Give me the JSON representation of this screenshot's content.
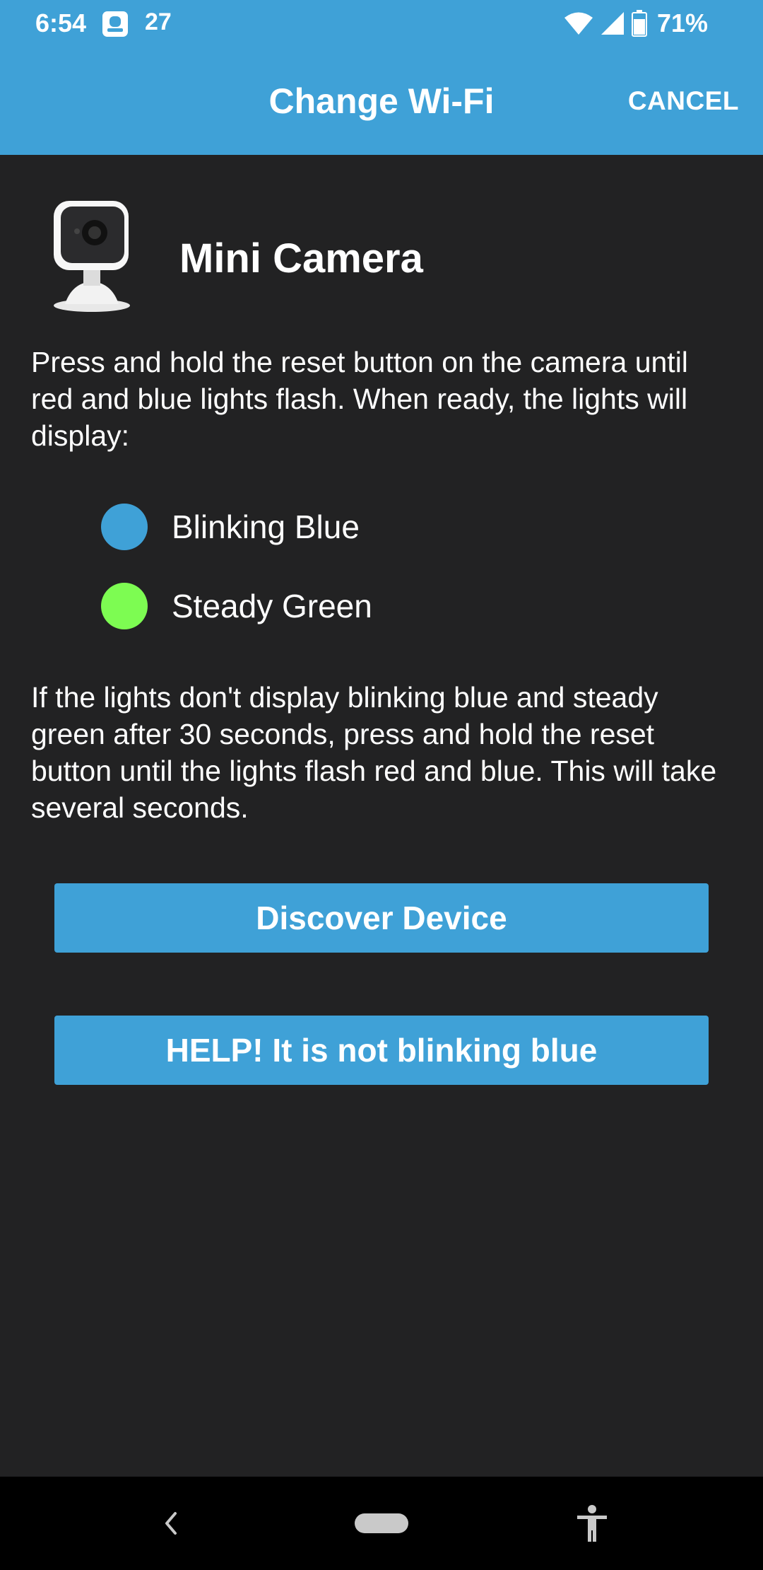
{
  "status_bar": {
    "time": "6:54",
    "notification_count": "27",
    "battery": "71%"
  },
  "app_bar": {
    "title": "Change Wi-Fi",
    "cancel_label": "CANCEL"
  },
  "device": {
    "name": "Mini Camera",
    "icon": "camera-icon"
  },
  "instructions": "Press and hold the reset button on the camera until red and blue lights flash. When ready, the lights will display:",
  "lights": [
    {
      "label": "Blinking Blue",
      "color": "#3fa1d7"
    },
    {
      "label": "Steady Green",
      "color": "#7dfc52"
    }
  ],
  "note": "If the lights don't display blinking blue and steady green after 30 seconds, press and hold the reset button until the lights flash red and blue. This will take several seconds.",
  "buttons": {
    "discover_label": "Discover Device",
    "help_label": "HELP! It is not blinking blue"
  },
  "colors": {
    "accent": "#3fa1d7",
    "background": "#222223"
  }
}
